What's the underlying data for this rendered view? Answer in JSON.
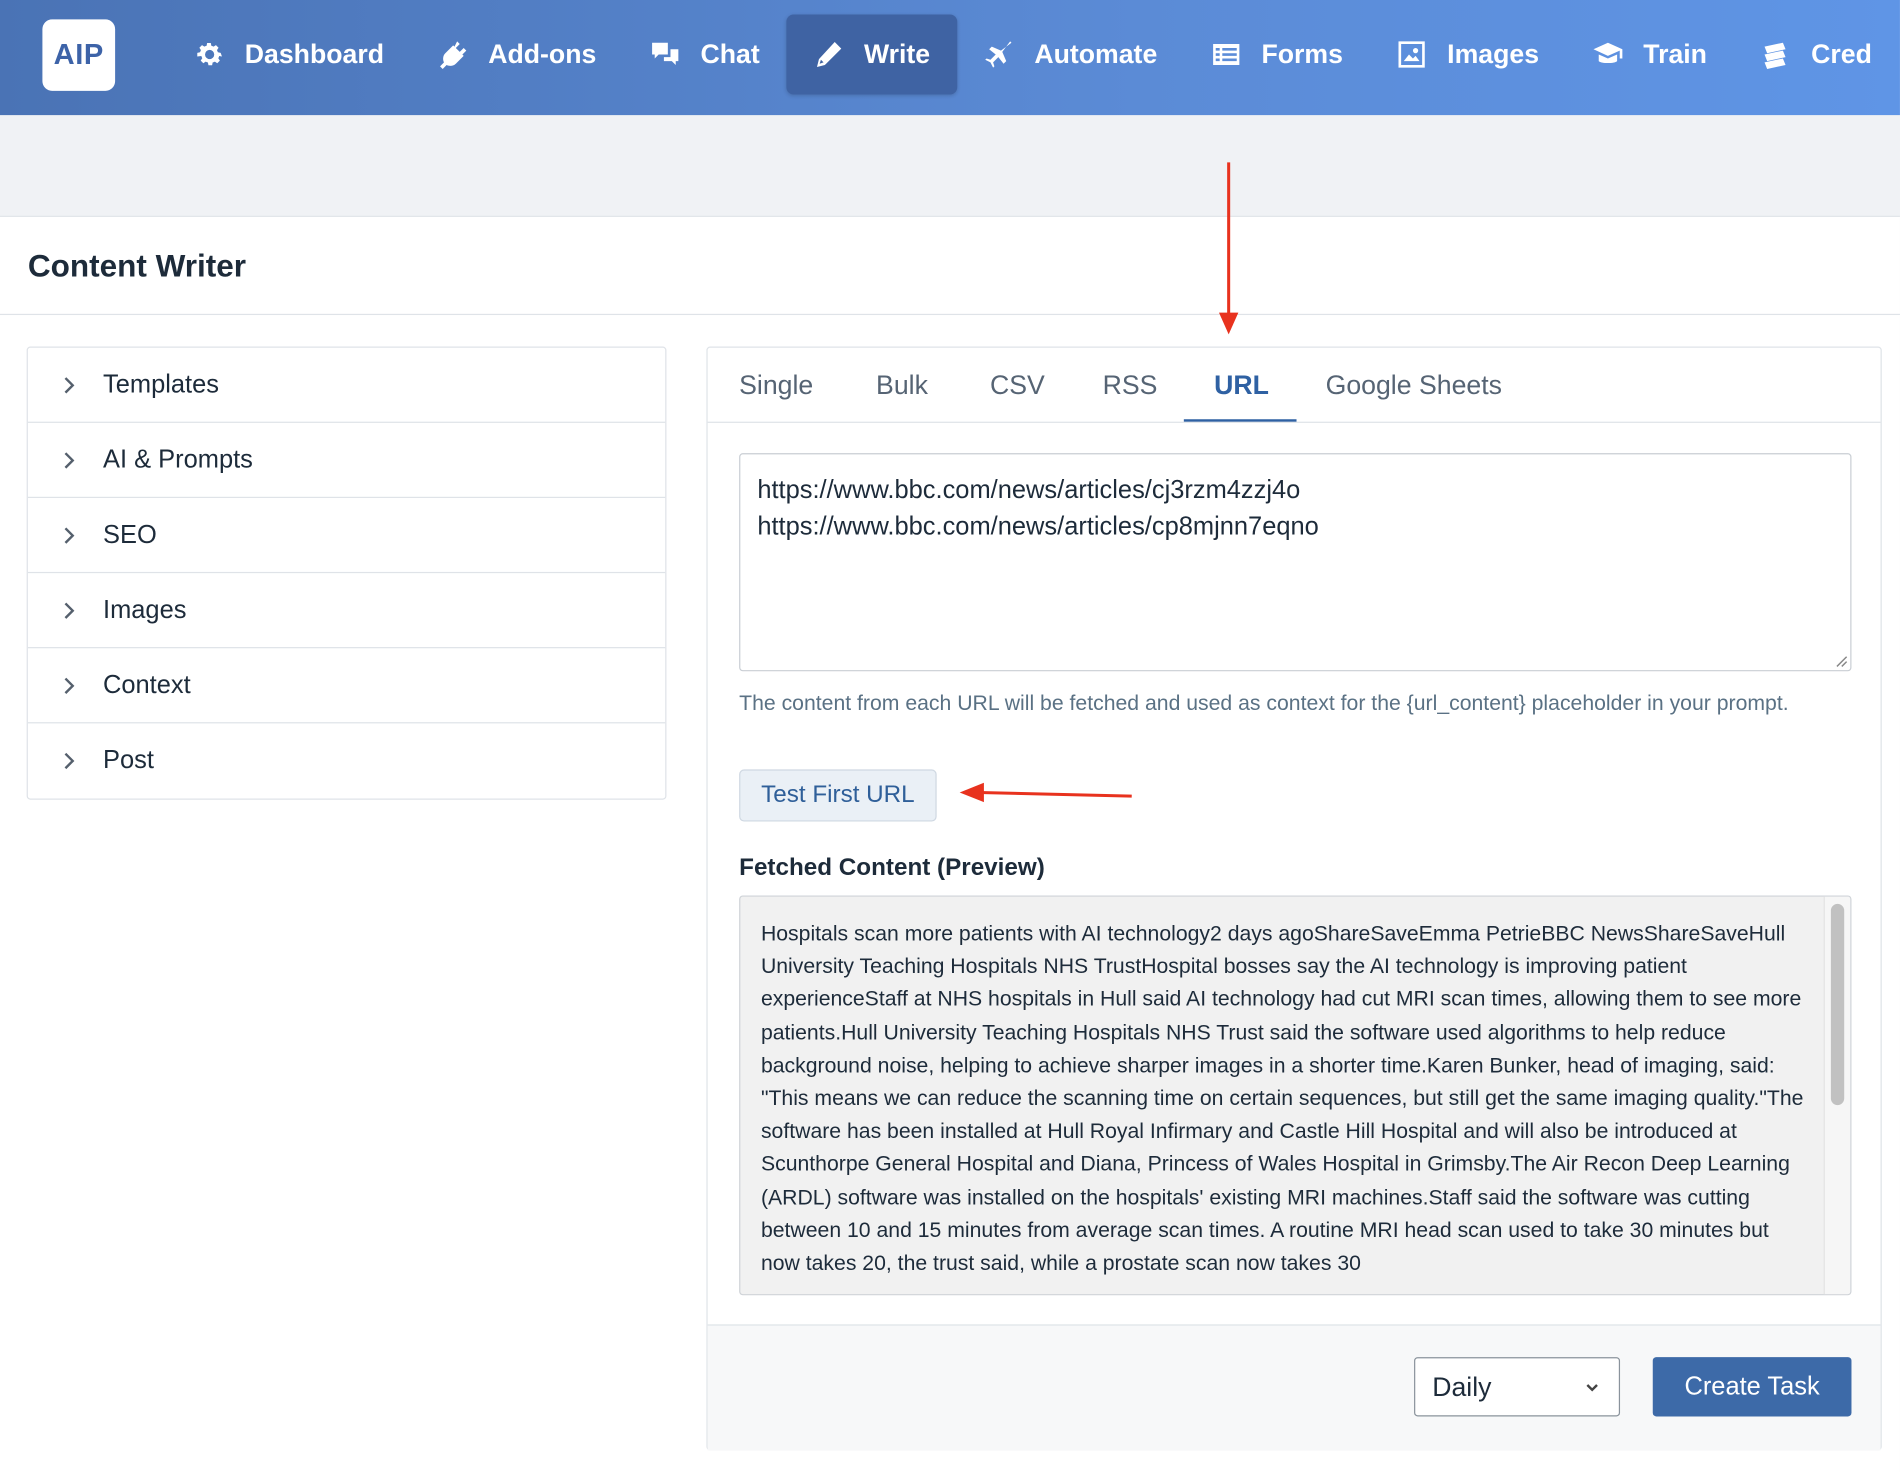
{
  "logo": "AIP",
  "nav": [
    {
      "label": "Dashboard",
      "icon": "gear-icon"
    },
    {
      "label": "Add-ons",
      "icon": "plug-icon"
    },
    {
      "label": "Chat",
      "icon": "chat-icon"
    },
    {
      "label": "Write",
      "icon": "pencil-icon",
      "active": true
    },
    {
      "label": "Automate",
      "icon": "plane-icon"
    },
    {
      "label": "Forms",
      "icon": "form-icon"
    },
    {
      "label": "Images",
      "icon": "image-icon"
    },
    {
      "label": "Train",
      "icon": "graduation-cap-icon"
    },
    {
      "label": "Cred",
      "icon": "credits-icon"
    }
  ],
  "page": {
    "title": "Content Writer"
  },
  "accordion": [
    "Templates",
    "AI & Prompts",
    "SEO",
    "Images",
    "Context",
    "Post"
  ],
  "tabs": [
    "Single",
    "Bulk",
    "CSV",
    "RSS",
    "URL",
    "Google Sheets"
  ],
  "active_tab": "URL",
  "url_input": {
    "line1": "https://www.bbc.com/news/articles/cj3rzm4zzj4o",
    "line2": "https://www.bbc.com/news/articles/cp8mjnn7eqno"
  },
  "help_text": "The content from each URL will be fetched and used as context for the {url_content} placeholder in your prompt.",
  "test_button": "Test First URL",
  "preview_label": "Fetched Content (Preview)",
  "preview_text": "Hospitals scan more patients with AI technology2 days agoShareSaveEmma PetrieBBC NewsShareSaveHull University Teaching Hospitals NHS TrustHospital bosses say the AI technology is improving patient experienceStaff at NHS hospitals in Hull said AI technology had cut MRI scan times, allowing them to see more patients.Hull University Teaching Hospitals NHS Trust said the software used algorithms to help reduce background noise, helping to achieve sharper images in a shorter time.Karen Bunker, head of imaging, said: \"This means we can reduce the scanning time on certain sequences, but still get the same imaging quality.\"The software has been installed at Hull Royal Infirmary and Castle Hill Hospital and will also be introduced at Scunthorpe General Hospital and Diana, Princess of Wales Hospital in Grimsby.The Air Recon Deep Learning (ARDL) software was installed on the hospitals' existing MRI machines.Staff said the software was cutting between 10 and 15 minutes from average scan times. A routine MRI head scan used to take 30 minutes but now takes 20, the trust said, while a prostate scan now takes 30",
  "schedule": {
    "selected": "Daily"
  },
  "create_button": "Create Task",
  "colors": {
    "nav": "#5b8bd6",
    "primary": "#3d6aa8",
    "annotation": "#e8321e"
  }
}
